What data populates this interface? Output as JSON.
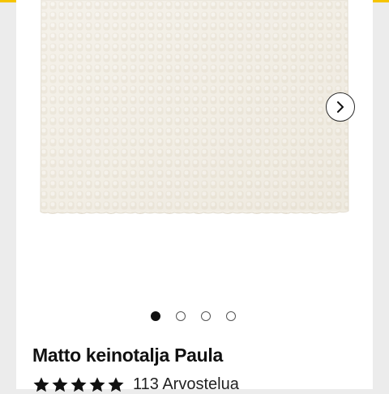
{
  "product": {
    "title": "Matto keinotalja Paula",
    "rating": 5,
    "max_rating": 5,
    "reviews_label": "113 Arvostelua",
    "image_count": 4,
    "active_image": 1
  },
  "colors": {
    "accent": "#f5c400",
    "rug": "#f2eee5",
    "background": "#ececec"
  },
  "icons": {
    "next": "chevron-right-icon",
    "star": "star-icon"
  }
}
